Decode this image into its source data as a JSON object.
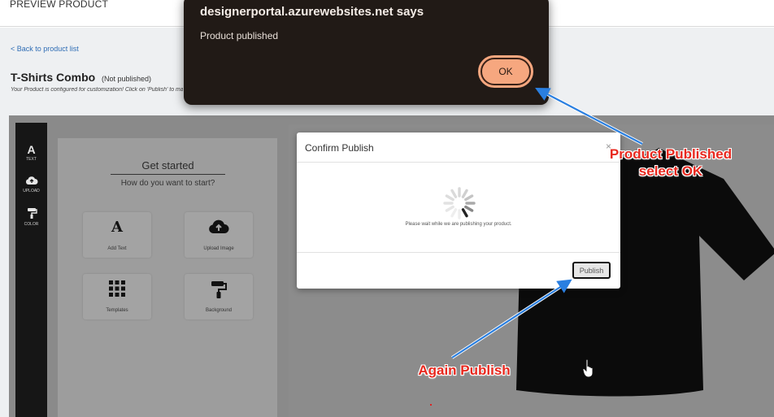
{
  "header": {
    "title": "PREVIEW PRODUCT"
  },
  "nav": {
    "back_label": "< Back to product list"
  },
  "product": {
    "name": "T-Shirts Combo",
    "status": "(Not published)",
    "hint": "Your Product is configured for customization! Click on 'Publish' to make it live"
  },
  "toolbar": {
    "items": [
      {
        "label": "TEXT",
        "icon": "text-icon"
      },
      {
        "label": "UPLOAD",
        "icon": "upload-cloud-icon"
      },
      {
        "label": "COLOR",
        "icon": "paint-roller-icon"
      }
    ]
  },
  "panel": {
    "title": "Get started",
    "subtitle": "How do you want to start?",
    "options": [
      {
        "label": "Add Text",
        "icon": "text-icon"
      },
      {
        "label": "Upload Image",
        "icon": "upload-cloud-icon"
      },
      {
        "label": "Templates",
        "icon": "grid-icon"
      },
      {
        "label": "Background",
        "icon": "paint-roller-icon"
      }
    ]
  },
  "modal": {
    "title": "Confirm Publish",
    "message": "Please wait while we are publishing your product.",
    "publish_label": "Publish"
  },
  "alert": {
    "origin": "designerportal.azurewebsites.net says",
    "message": "Product published",
    "ok_label": "OK"
  },
  "annotations": {
    "line1": "Product Published",
    "line2": "select OK",
    "again": "Again Publish"
  },
  "colors": {
    "annotation": "#e8281e",
    "arrow": "#2a7fe0",
    "ok_button": "#f6a77f",
    "alert_bg": "#211a16"
  }
}
